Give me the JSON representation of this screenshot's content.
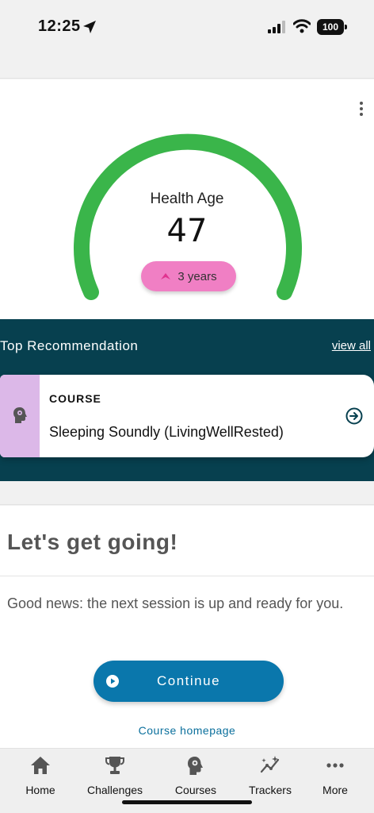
{
  "status_bar": {
    "time": "12:25",
    "battery": "100"
  },
  "health": {
    "label": "Health Age",
    "value": "47",
    "badge_text": "3 years",
    "gauge_color": "#3ab54a",
    "badge_color": "#f07fc4"
  },
  "recommendation": {
    "title": "Top Recommendation",
    "view_all": "view all",
    "card": {
      "type": "COURSE",
      "name": "Sleeping Soundly (LivingWellRested)",
      "side_color": "#dcb8e8"
    }
  },
  "session": {
    "title": "Let's get going!",
    "text": "Good news: the next session is up and ready for you.",
    "continue_label": "Continue",
    "homepage_link": "Course homepage"
  },
  "nav": {
    "items": [
      {
        "label": "Home",
        "icon": "home-icon"
      },
      {
        "label": "Challenges",
        "icon": "trophy-icon"
      },
      {
        "label": "Courses",
        "icon": "brain-head-icon"
      },
      {
        "label": "Trackers",
        "icon": "trackers-icon"
      },
      {
        "label": "More",
        "icon": "more-icon"
      }
    ]
  }
}
